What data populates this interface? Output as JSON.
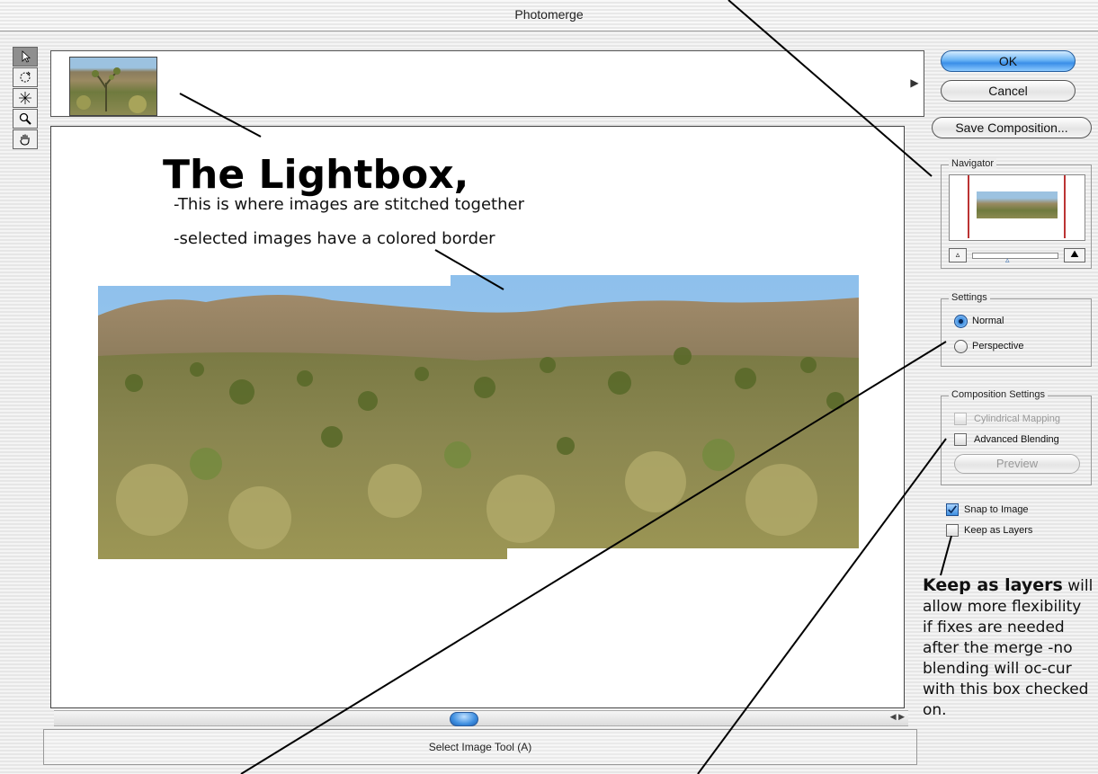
{
  "window": {
    "title": "Photomerge"
  },
  "tools": [
    {
      "icon": "select-image-tool-icon",
      "active": true
    },
    {
      "icon": "rotate-image-tool-icon",
      "active": false
    },
    {
      "icon": "vanishing-point-tool-icon",
      "active": false
    },
    {
      "icon": "zoom-tool-icon",
      "active": false
    },
    {
      "icon": "hand-tool-icon",
      "active": false
    }
  ],
  "lightbox": {
    "heading": "The Lightbox,",
    "line1": "-This is where images are stitched together",
    "line2": "-selected images have a colored border"
  },
  "buttons": {
    "ok": "OK",
    "cancel": "Cancel",
    "save_composition": "Save Composition...",
    "preview": "Preview"
  },
  "navigator": {
    "label": "Navigator"
  },
  "settings": {
    "label": "Settings",
    "normal": "Normal",
    "perspective": "Perspective",
    "selected": "Normal"
  },
  "composition_settings": {
    "label": "Composition Settings",
    "cylindrical_mapping": "Cylindrical Mapping",
    "advanced_blending": "Advanced Blending"
  },
  "options": {
    "snap_to_image": "Snap to Image",
    "snap_to_image_checked": true,
    "keep_as_layers": "Keep as Layers",
    "keep_as_layers_checked": false
  },
  "status": {
    "text": "Select Image Tool (A)"
  },
  "annotation": {
    "bold": "Keep as layers",
    "text": "will allow more flexibility if fixes are needed after the merge -no blending will oc-cur with this box checked on."
  },
  "colors": {
    "accent": "#3f8fe0",
    "window_bg": "#eeeeee"
  }
}
